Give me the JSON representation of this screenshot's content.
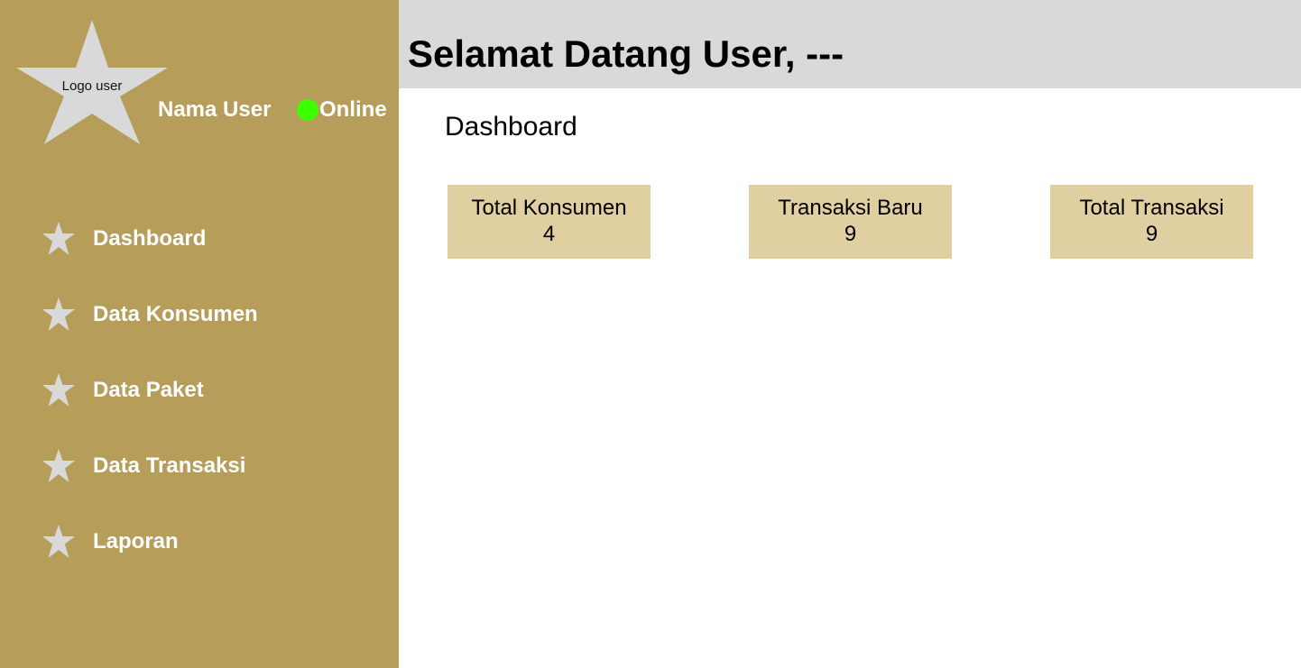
{
  "sidebar": {
    "logo_label": "Logo user",
    "user_name": "Nama User",
    "status": "Online",
    "status_color": "#3cff00",
    "background_color": "#b69d5a",
    "items": [
      {
        "label": "Dashboard",
        "icon": "star-icon"
      },
      {
        "label": "Data Konsumen",
        "icon": "star-icon"
      },
      {
        "label": "Data Paket",
        "icon": "star-icon"
      },
      {
        "label": "Data Transaksi",
        "icon": "star-icon"
      },
      {
        "label": "Laporan",
        "icon": "star-icon"
      }
    ]
  },
  "header": {
    "title": "Selamat Datang User, ---"
  },
  "main": {
    "page_title": "Dashboard",
    "cards": [
      {
        "label": "Total Konsumen",
        "value": "4"
      },
      {
        "label": "Transaksi Baru",
        "value": "9"
      },
      {
        "label": "Total Transaksi",
        "value": "9"
      }
    ],
    "card_color": "#e0cfa1"
  }
}
